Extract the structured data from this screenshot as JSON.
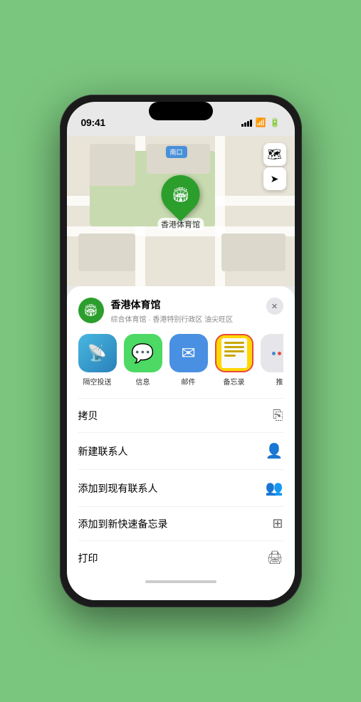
{
  "status_bar": {
    "time": "09:41",
    "location_arrow": "▶"
  },
  "map": {
    "label_tag": "南口",
    "pin_label": "香港体育馆",
    "controls": {
      "map_btn": "🗺",
      "location_btn": "➤"
    }
  },
  "bottom_sheet": {
    "location_name": "香港体育馆",
    "location_sub": "综合体育馆 · 香港特别行政区 油尖旺区",
    "close_label": "✕",
    "share_icons": [
      {
        "id": "airdrop",
        "label": "隔空投送",
        "icon": "📡"
      },
      {
        "id": "message",
        "label": "信息",
        "icon": "💬"
      },
      {
        "id": "mail",
        "label": "邮件",
        "icon": "✉"
      },
      {
        "id": "notes",
        "label": "备忘录",
        "icon": "📝"
      },
      {
        "id": "more",
        "label": "推",
        "icon": "···"
      }
    ],
    "actions": [
      {
        "id": "copy",
        "label": "拷贝",
        "icon": "⎘"
      },
      {
        "id": "new-contact",
        "label": "新建联系人",
        "icon": "👤"
      },
      {
        "id": "add-contact",
        "label": "添加到现有联系人",
        "icon": "👤"
      },
      {
        "id": "add-notes",
        "label": "添加到新快速备忘录",
        "icon": "⊞"
      },
      {
        "id": "print",
        "label": "打印",
        "icon": "🖨"
      }
    ]
  }
}
